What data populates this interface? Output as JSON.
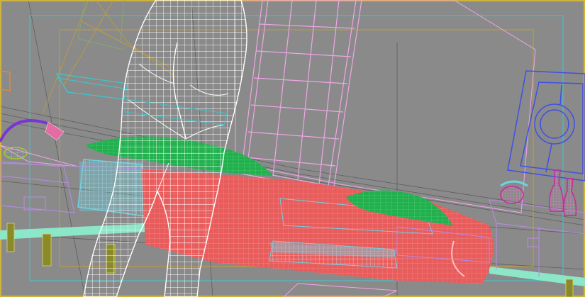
{
  "viewport": {
    "view": "perspective",
    "shading": "wireframe",
    "safe_frame": "on",
    "background_color": "#8a8a8a"
  },
  "colors": {
    "figure_wire": "#ffffff",
    "sofa": "#e85c5c",
    "pillow": "#22b04f",
    "cushion": "#6fd3e3",
    "window": "#f0a6e6",
    "door_outline": "#3f50e6",
    "vase": "#c82a9c",
    "lamp_cord": "#7a35d4",
    "floor_strip": "#8ce6c8",
    "frame_outer": "#3cc8d2",
    "frame_inner": "#c4a030",
    "viewport_border": "#d0b33a"
  },
  "objects": [
    "wireframe-figure",
    "sofa",
    "pillow-left",
    "pillow-right",
    "window-grid",
    "door-frame",
    "vases",
    "floor-lamp",
    "side-table"
  ]
}
